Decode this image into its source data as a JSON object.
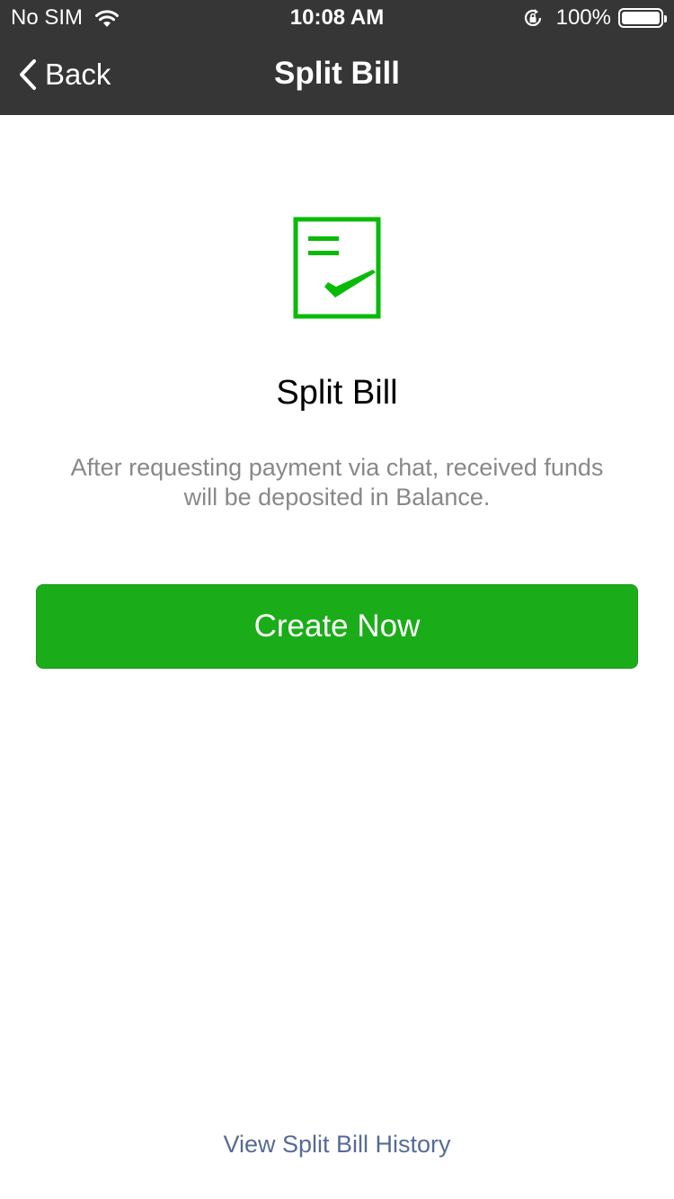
{
  "status_bar": {
    "carrier": "No SIM",
    "time": "10:08 AM",
    "battery": "100%",
    "icons": [
      "wifi-icon",
      "rotation-lock-icon",
      "battery-icon"
    ]
  },
  "navbar": {
    "back_label": "Back",
    "title": "Split Bill"
  },
  "main": {
    "icon": "bill-check-icon",
    "heading": "Split Bill",
    "description": "After requesting payment via chat, received funds will be deposited in Balance.",
    "create_button_label": "Create Now",
    "history_link": "View Split Bill History"
  },
  "colors": {
    "navbar_bg": "#363636",
    "accent_green": "#1aad19",
    "icon_green": "#09bb07",
    "link_blue": "#576b95",
    "secondary_text": "#888888"
  }
}
